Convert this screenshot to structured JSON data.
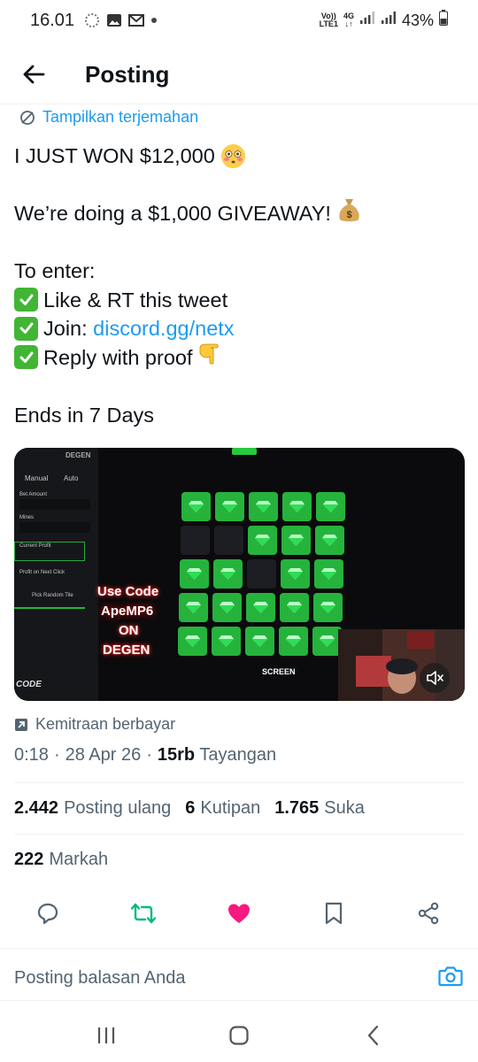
{
  "status_bar": {
    "time": "16.01",
    "network_line1": "Vo))",
    "network_line2": "LTE1",
    "network_type_top": "4G",
    "network_type_bottom": "↓↑",
    "battery": "43%"
  },
  "header": {
    "title": "Posting"
  },
  "translate_label": "Tampilkan terjemahan",
  "tweet": {
    "line1": "I JUST WON $12,000",
    "line2": "We’re doing a $1,000 GIVEAWAY!",
    "line3": "To enter:",
    "item1": "Like & RT this tweet",
    "item2_prefix": "Join: ",
    "item2_link": "discord.gg/netx",
    "item3": "Reply with proof",
    "line4": "Ends in 7 Days"
  },
  "media": {
    "overlay_line1": "Use Code",
    "overlay_line2": "ApeMP6",
    "overlay_line3": "ON",
    "overlay_line4": "DEGEN",
    "screen_label": "SCREEN",
    "brand": "DEGEN",
    "code_label": "CODE",
    "panel_labels": [
      "Manual",
      "Auto",
      "Bet Amount",
      "Mines",
      "Current Profit",
      "Profit on Next Click",
      "Pick Random Tile"
    ]
  },
  "paid_partnership": "Kemitraan berbayar",
  "meta": {
    "time": "0:18",
    "date": "28 Apr 26",
    "views_count": "15rb",
    "views_label": "Tayangan",
    "sep": "·"
  },
  "stats": {
    "reposts_count": "2.442",
    "reposts_label": "Posting ulang",
    "quotes_count": "6",
    "quotes_label": "Kutipan",
    "likes_count": "1.765",
    "likes_label": "Suka",
    "bookmarks_count": "222",
    "bookmarks_label": "Markah"
  },
  "reply_placeholder": "Posting balasan Anda",
  "colors": {
    "accent": "#1d9bf0",
    "like": "#f91880",
    "repost": "#00ba7c",
    "gem_tile": "#25b33c"
  }
}
